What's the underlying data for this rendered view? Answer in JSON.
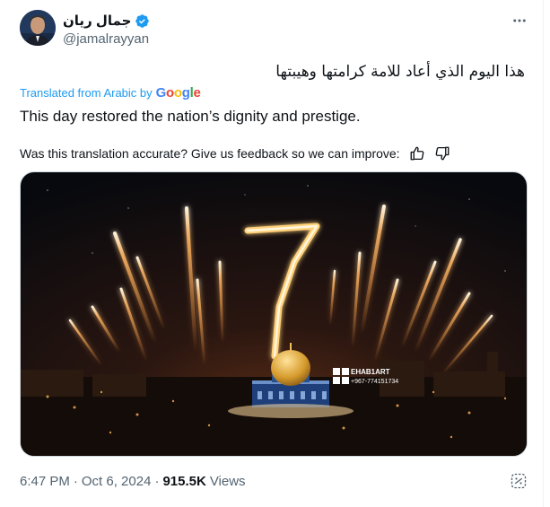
{
  "tweet": {
    "display_name": "جمال ريان",
    "handle": "@jamalrayyan",
    "text_arabic": "هذا اليوم الذي أعاد للامة كرامتها وهيبتها",
    "translated_from": "Translated from Arabic by",
    "translator_brand": "Google",
    "text_english": "This day restored the nation’s dignity and prestige.",
    "feedback_prompt": "Was this translation accurate? Give us feedback so we can improve:",
    "image": {
      "big_number": "7",
      "watermark_name": "EHAB1ART",
      "watermark_phone": "+967-774151734"
    },
    "time": "6:47 PM",
    "dot": "·",
    "date": "Oct 6, 2024",
    "dot2": "·",
    "views_count": "915.5K",
    "views_label": "Views"
  },
  "icons": {
    "verified": "verified-badge-icon",
    "more": "more-dots-icon",
    "thumbs_up": "thumbs-up-icon",
    "thumbs_down": "thumbs-down-icon",
    "grok": "grok-icon"
  },
  "colors": {
    "accent": "#1d9bf0",
    "text": "#0f1419",
    "secondary": "#536471"
  }
}
